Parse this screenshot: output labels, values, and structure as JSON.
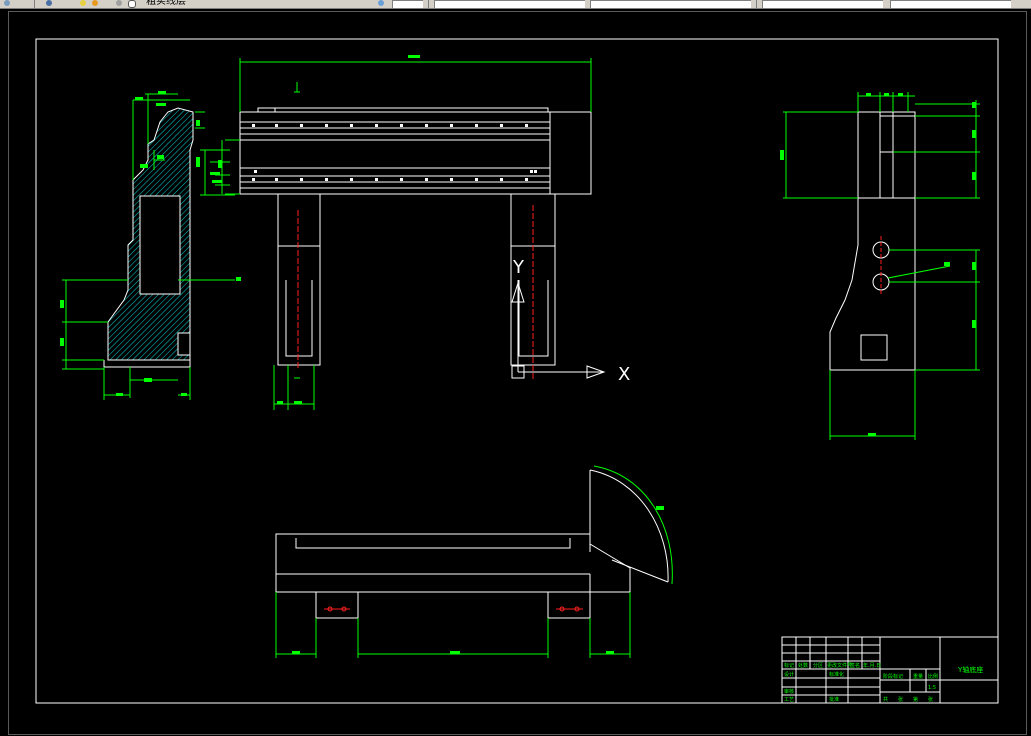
{
  "toolbar": {
    "layer_name": "粗实线层",
    "field_2": "",
    "field_3": "",
    "field_4": "",
    "field_5": "",
    "field_6": ""
  },
  "drawing": {
    "ucs": {
      "x_label": "X",
      "y_label": "Y"
    },
    "title_block": {
      "part_name": "Y轴底座",
      "col_labels": [
        "标记",
        "处数",
        "分区",
        "更改文件号",
        "签名",
        "年.月.日"
      ],
      "row_labels": [
        "设计",
        "审核",
        "工艺"
      ],
      "std_label": "标准化",
      "approve_label": "批准",
      "stage_label": "阶段标记",
      "weight_label": "重量",
      "scale_label": "比例",
      "scale_value": "1:5",
      "sheet_labels": [
        "共",
        "张",
        "第",
        "张"
      ]
    }
  },
  "colors": {
    "outline": "#ffffff",
    "dimension": "#00ff00",
    "hatch": "#00d0d0",
    "centerline": "#ff2020",
    "border": "#ffffff",
    "background": "#000000"
  }
}
